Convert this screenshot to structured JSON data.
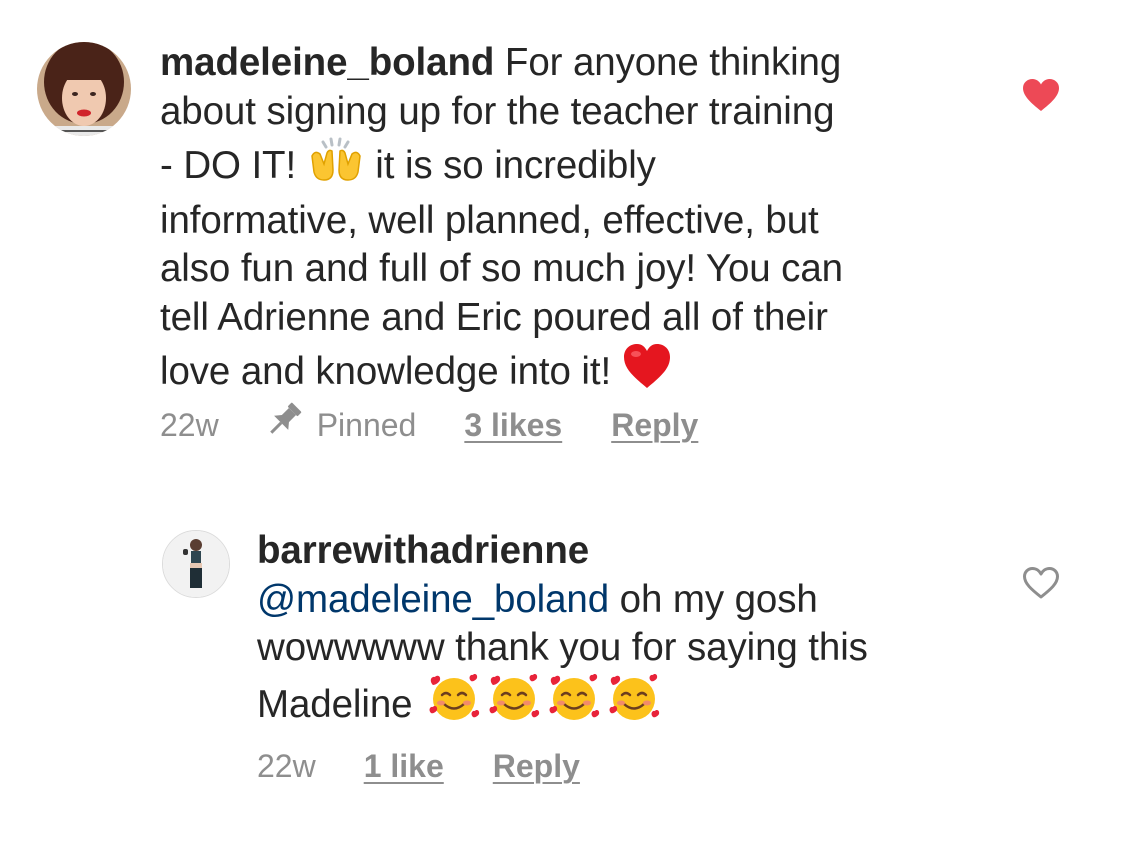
{
  "comments": [
    {
      "username": "madeleine_boland",
      "lines": [
        "For anyone thinking",
        "about signing up for the teacher training",
        "- DO IT!",
        "it is so incredibly",
        "informative, well planned, effective, but",
        "also fun and full of so much joy! You can",
        "tell Adrienne and Eric poured all of their",
        "love and knowledge into it!"
      ],
      "emojis": [
        "raising-hands-icon",
        "red-heart-icon"
      ],
      "time": "22w",
      "pinned_label": "Pinned",
      "likes": "3 likes",
      "reply": "Reply",
      "liked": true,
      "heart_color": "#ed4956"
    },
    {
      "username": "barrewithadrienne",
      "mention": "@madeleine_boland",
      "lines": [
        "oh my gosh",
        "wowwwww thank you for saying this",
        "Madeline"
      ],
      "emojis": [
        "smiling-face-with-hearts-icon"
      ],
      "time": "22w",
      "likes": "1 like",
      "reply": "Reply",
      "liked": false,
      "mention_color": "#00376b"
    }
  ]
}
